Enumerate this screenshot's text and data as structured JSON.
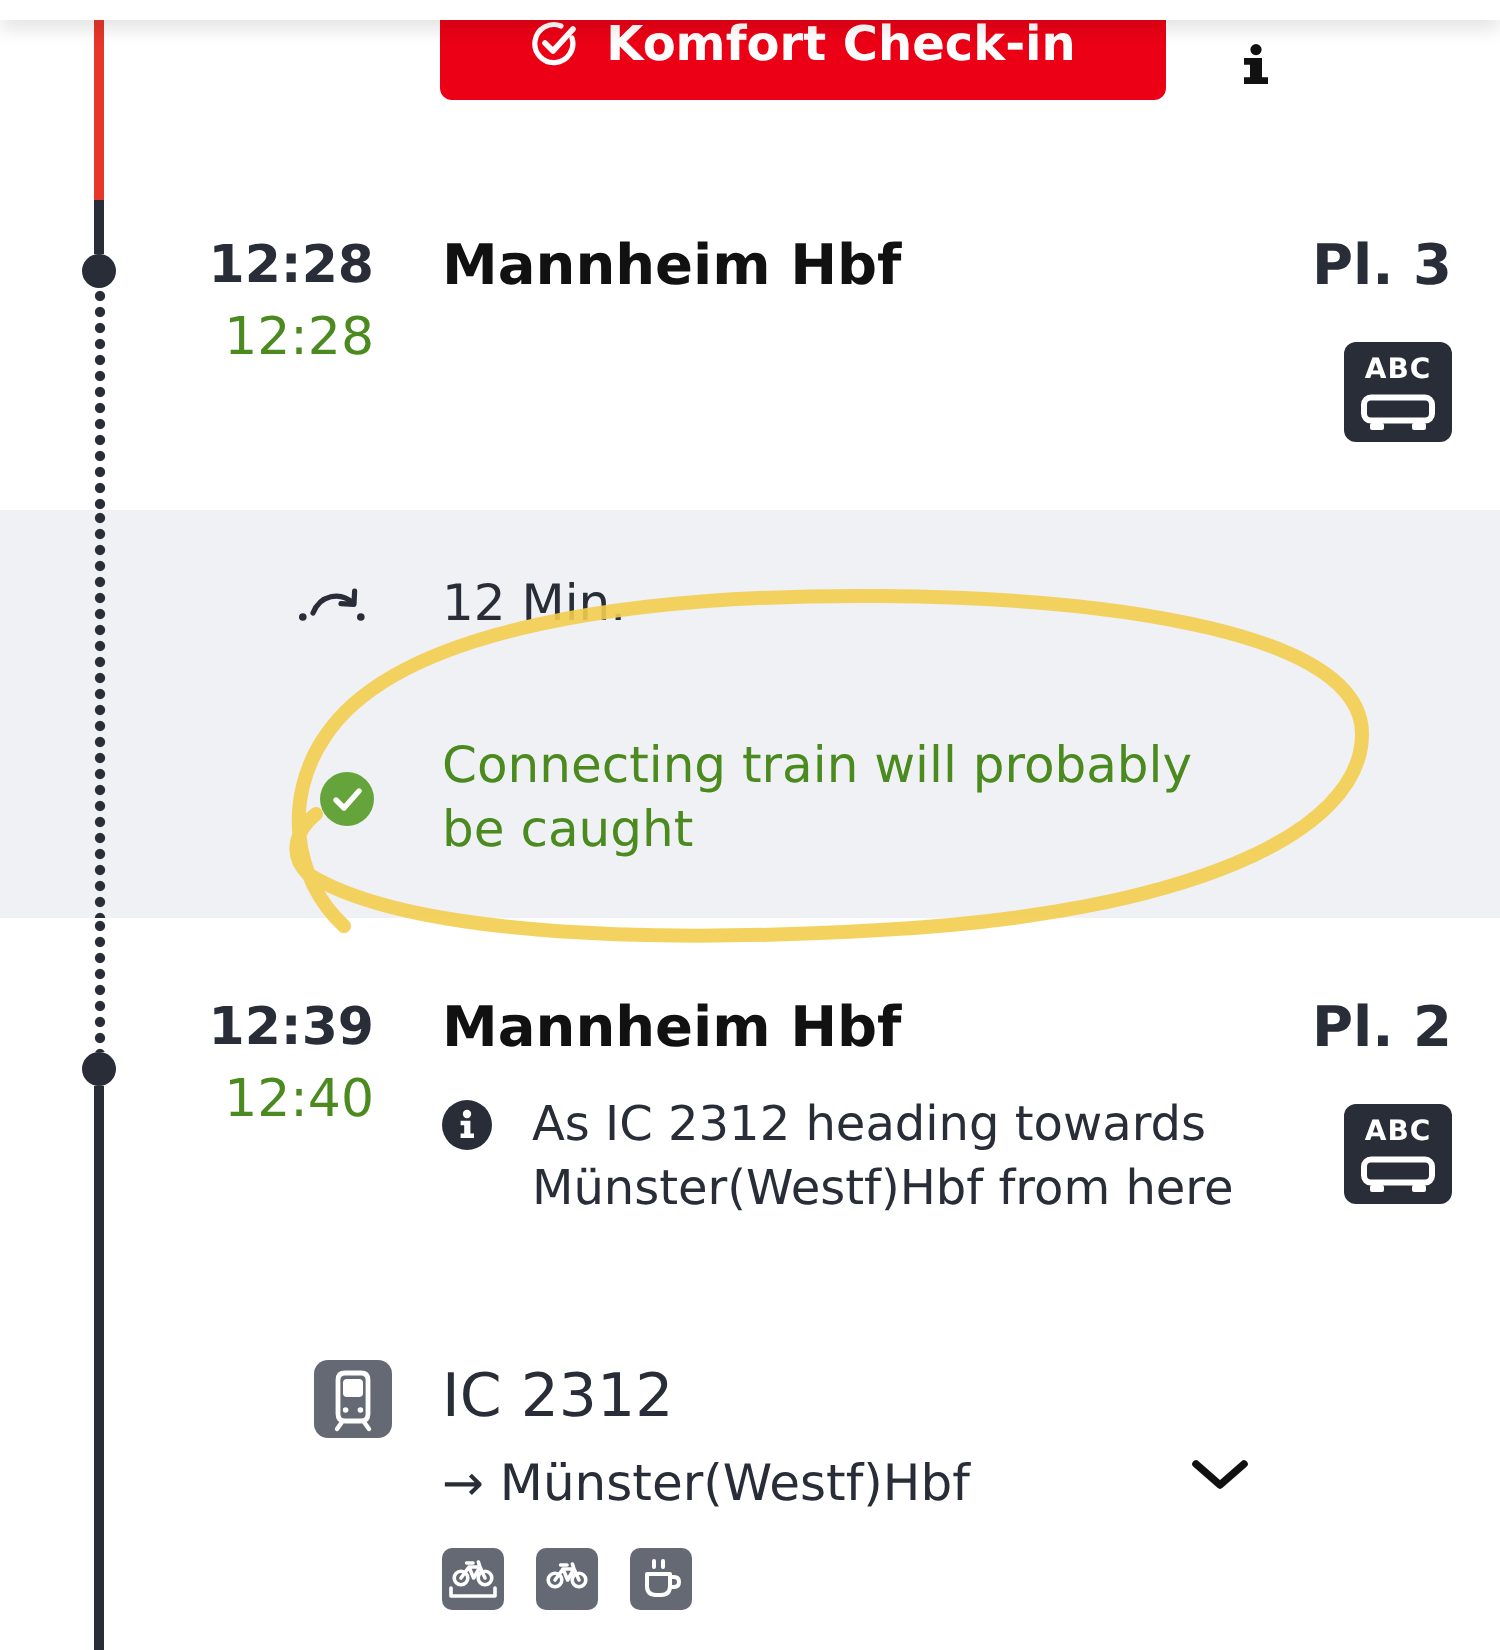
{
  "sections": [
    {
      "kind": "checkin",
      "accent": true,
      "button": "Komfort Check-in"
    },
    {
      "kind": "stop",
      "dotted_above": false,
      "dotted_below": true,
      "scheduled": "12:28",
      "actual": "12:28",
      "on_time": true,
      "station": "Mannheim Hbf",
      "platform": "Pl. 3",
      "coach_label": "ABC"
    },
    {
      "kind": "transfer",
      "dotted": true,
      "duration": "12 Min.",
      "status": "Connecting train will probably be caught",
      "ok": true,
      "highlighted": true
    },
    {
      "kind": "stop",
      "dotted_above": true,
      "dotted_below": false,
      "scheduled": "12:39",
      "actual": "12:40",
      "on_time": true,
      "station": "Mannheim Hbf",
      "platform": "Pl. 2",
      "coach_label": "ABC",
      "note": "As IC 2312 heading towards Münster(Westf)Hbf from here"
    },
    {
      "kind": "train",
      "dotted": false,
      "name": "IC 2312",
      "direction": "→ Münster(Westf)Hbf",
      "expanded": false,
      "amenities": [
        {
          "kind": "bike_reservation"
        },
        {
          "kind": "bike"
        },
        {
          "kind": "bistro"
        }
      ]
    }
  ]
}
